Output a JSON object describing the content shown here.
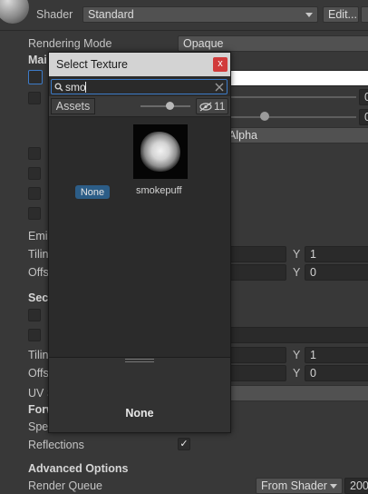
{
  "inspector": {
    "shader_label": "Shader",
    "shader_value": "Standard",
    "edit_button": "Edit...",
    "rendering_mode_label": "Rendering Mode",
    "rendering_mode_value": "Opaque",
    "main_maps_partial": "Mai",
    "alpha_partial": "Alpha",
    "value_a": "0",
    "value_b": "0",
    "emission_partial": "Emis",
    "tiling_partial_1": "Tilin",
    "offset_partial_1": "Offs",
    "y_label_1": "Y",
    "tiling_y_1": "1",
    "y_label_2": "Y",
    "offset_y_1": "0",
    "secondary_partial": "Sec",
    "tiling_partial_2": "Tilin",
    "offset_partial_2": "Offs",
    "y_label_3": "Y",
    "tiling_y_2": "1",
    "y_label_4": "Y",
    "offset_y_2": "0",
    "uv_partial": "UV S",
    "forward_partial": "Forw",
    "specular_partial": "Spe",
    "reflections_label": "Reflections",
    "reflections_check": "✓",
    "advanced_title": "Advanced Options",
    "render_queue_label": "Render Queue",
    "render_queue_mode": "From Shader",
    "render_queue_value": "200"
  },
  "popup": {
    "title": "Select Texture",
    "close_glyph": "x",
    "search_value": "smo",
    "assets_tab": "Assets",
    "hidden_count": "11",
    "items": [
      {
        "label": "None"
      },
      {
        "label": "smokepuff"
      }
    ],
    "preview_label": "None"
  },
  "colors": {
    "background": "#383838",
    "popup_title_bg": "#d3d3d3",
    "close_button": "#d13b3b",
    "selection_blue": "#2c5d87",
    "search_focus": "#3d7bc8"
  },
  "icons": [
    "shader-sphere-icon",
    "search-icon",
    "visibility-hidden-icon",
    "slider-handle-icon",
    "checkmark-icon",
    "caret-down-icon"
  ]
}
